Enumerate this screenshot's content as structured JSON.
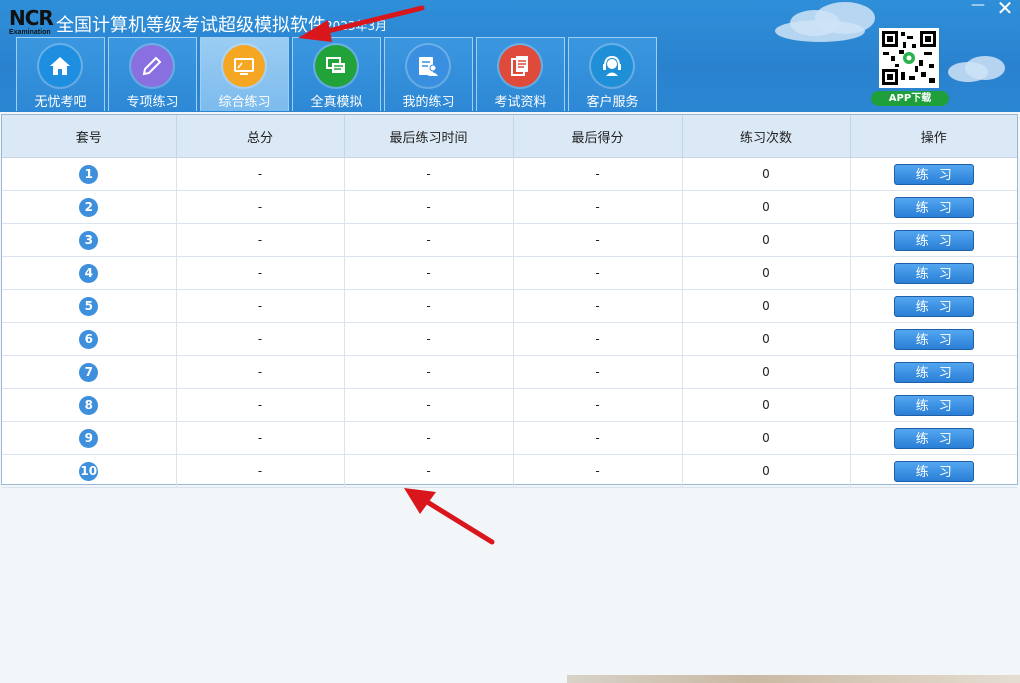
{
  "window": {
    "title": "全国计算机等级考试超级模拟软件",
    "title_suffix": "2023年3月",
    "logo_top": "NCR",
    "logo_sub": "Examination",
    "minimize": "—",
    "close": "✕"
  },
  "nav": [
    {
      "label": "无忧考吧",
      "icon": "home-icon",
      "color": "#1e8fe0"
    },
    {
      "label": "专项练习",
      "icon": "pencil-icon",
      "color": "#8a6fe0"
    },
    {
      "label": "综合练习",
      "icon": "monitor-icon",
      "color": "#f5a623",
      "active": true
    },
    {
      "label": "全真模拟",
      "icon": "chat-icon",
      "color": "#22a33a"
    },
    {
      "label": "我的练习",
      "icon": "user-card-icon",
      "color": "#3a8fe0"
    },
    {
      "label": "考试资料",
      "icon": "document-icon",
      "color": "#e04a3a"
    },
    {
      "label": "客户服务",
      "icon": "headset-icon",
      "color": "#1f8fd8"
    }
  ],
  "app_download": "APP下载",
  "table": {
    "headers": [
      "套号",
      "总分",
      "最后练习时间",
      "最后得分",
      "练习次数",
      "操作"
    ],
    "rows": [
      {
        "num": "1",
        "total": "-",
        "last_time": "-",
        "last_score": "-",
        "count": "0",
        "action": "练习"
      },
      {
        "num": "2",
        "total": "-",
        "last_time": "-",
        "last_score": "-",
        "count": "0",
        "action": "练习"
      },
      {
        "num": "3",
        "total": "-",
        "last_time": "-",
        "last_score": "-",
        "count": "0",
        "action": "练习"
      },
      {
        "num": "4",
        "total": "-",
        "last_time": "-",
        "last_score": "-",
        "count": "0",
        "action": "练习"
      },
      {
        "num": "5",
        "total": "-",
        "last_time": "-",
        "last_score": "-",
        "count": "0",
        "action": "练习"
      },
      {
        "num": "6",
        "total": "-",
        "last_time": "-",
        "last_score": "-",
        "count": "0",
        "action": "练习"
      },
      {
        "num": "7",
        "total": "-",
        "last_time": "-",
        "last_score": "-",
        "count": "0",
        "action": "练习"
      },
      {
        "num": "8",
        "total": "-",
        "last_time": "-",
        "last_score": "-",
        "count": "0",
        "action": "练习"
      },
      {
        "num": "9",
        "total": "-",
        "last_time": "-",
        "last_score": "-",
        "count": "0",
        "action": "练习"
      },
      {
        "num": "10",
        "total": "-",
        "last_time": "-",
        "last_score": "-",
        "count": "0",
        "action": "练习"
      }
    ]
  },
  "annotation_color": "#d9161c"
}
